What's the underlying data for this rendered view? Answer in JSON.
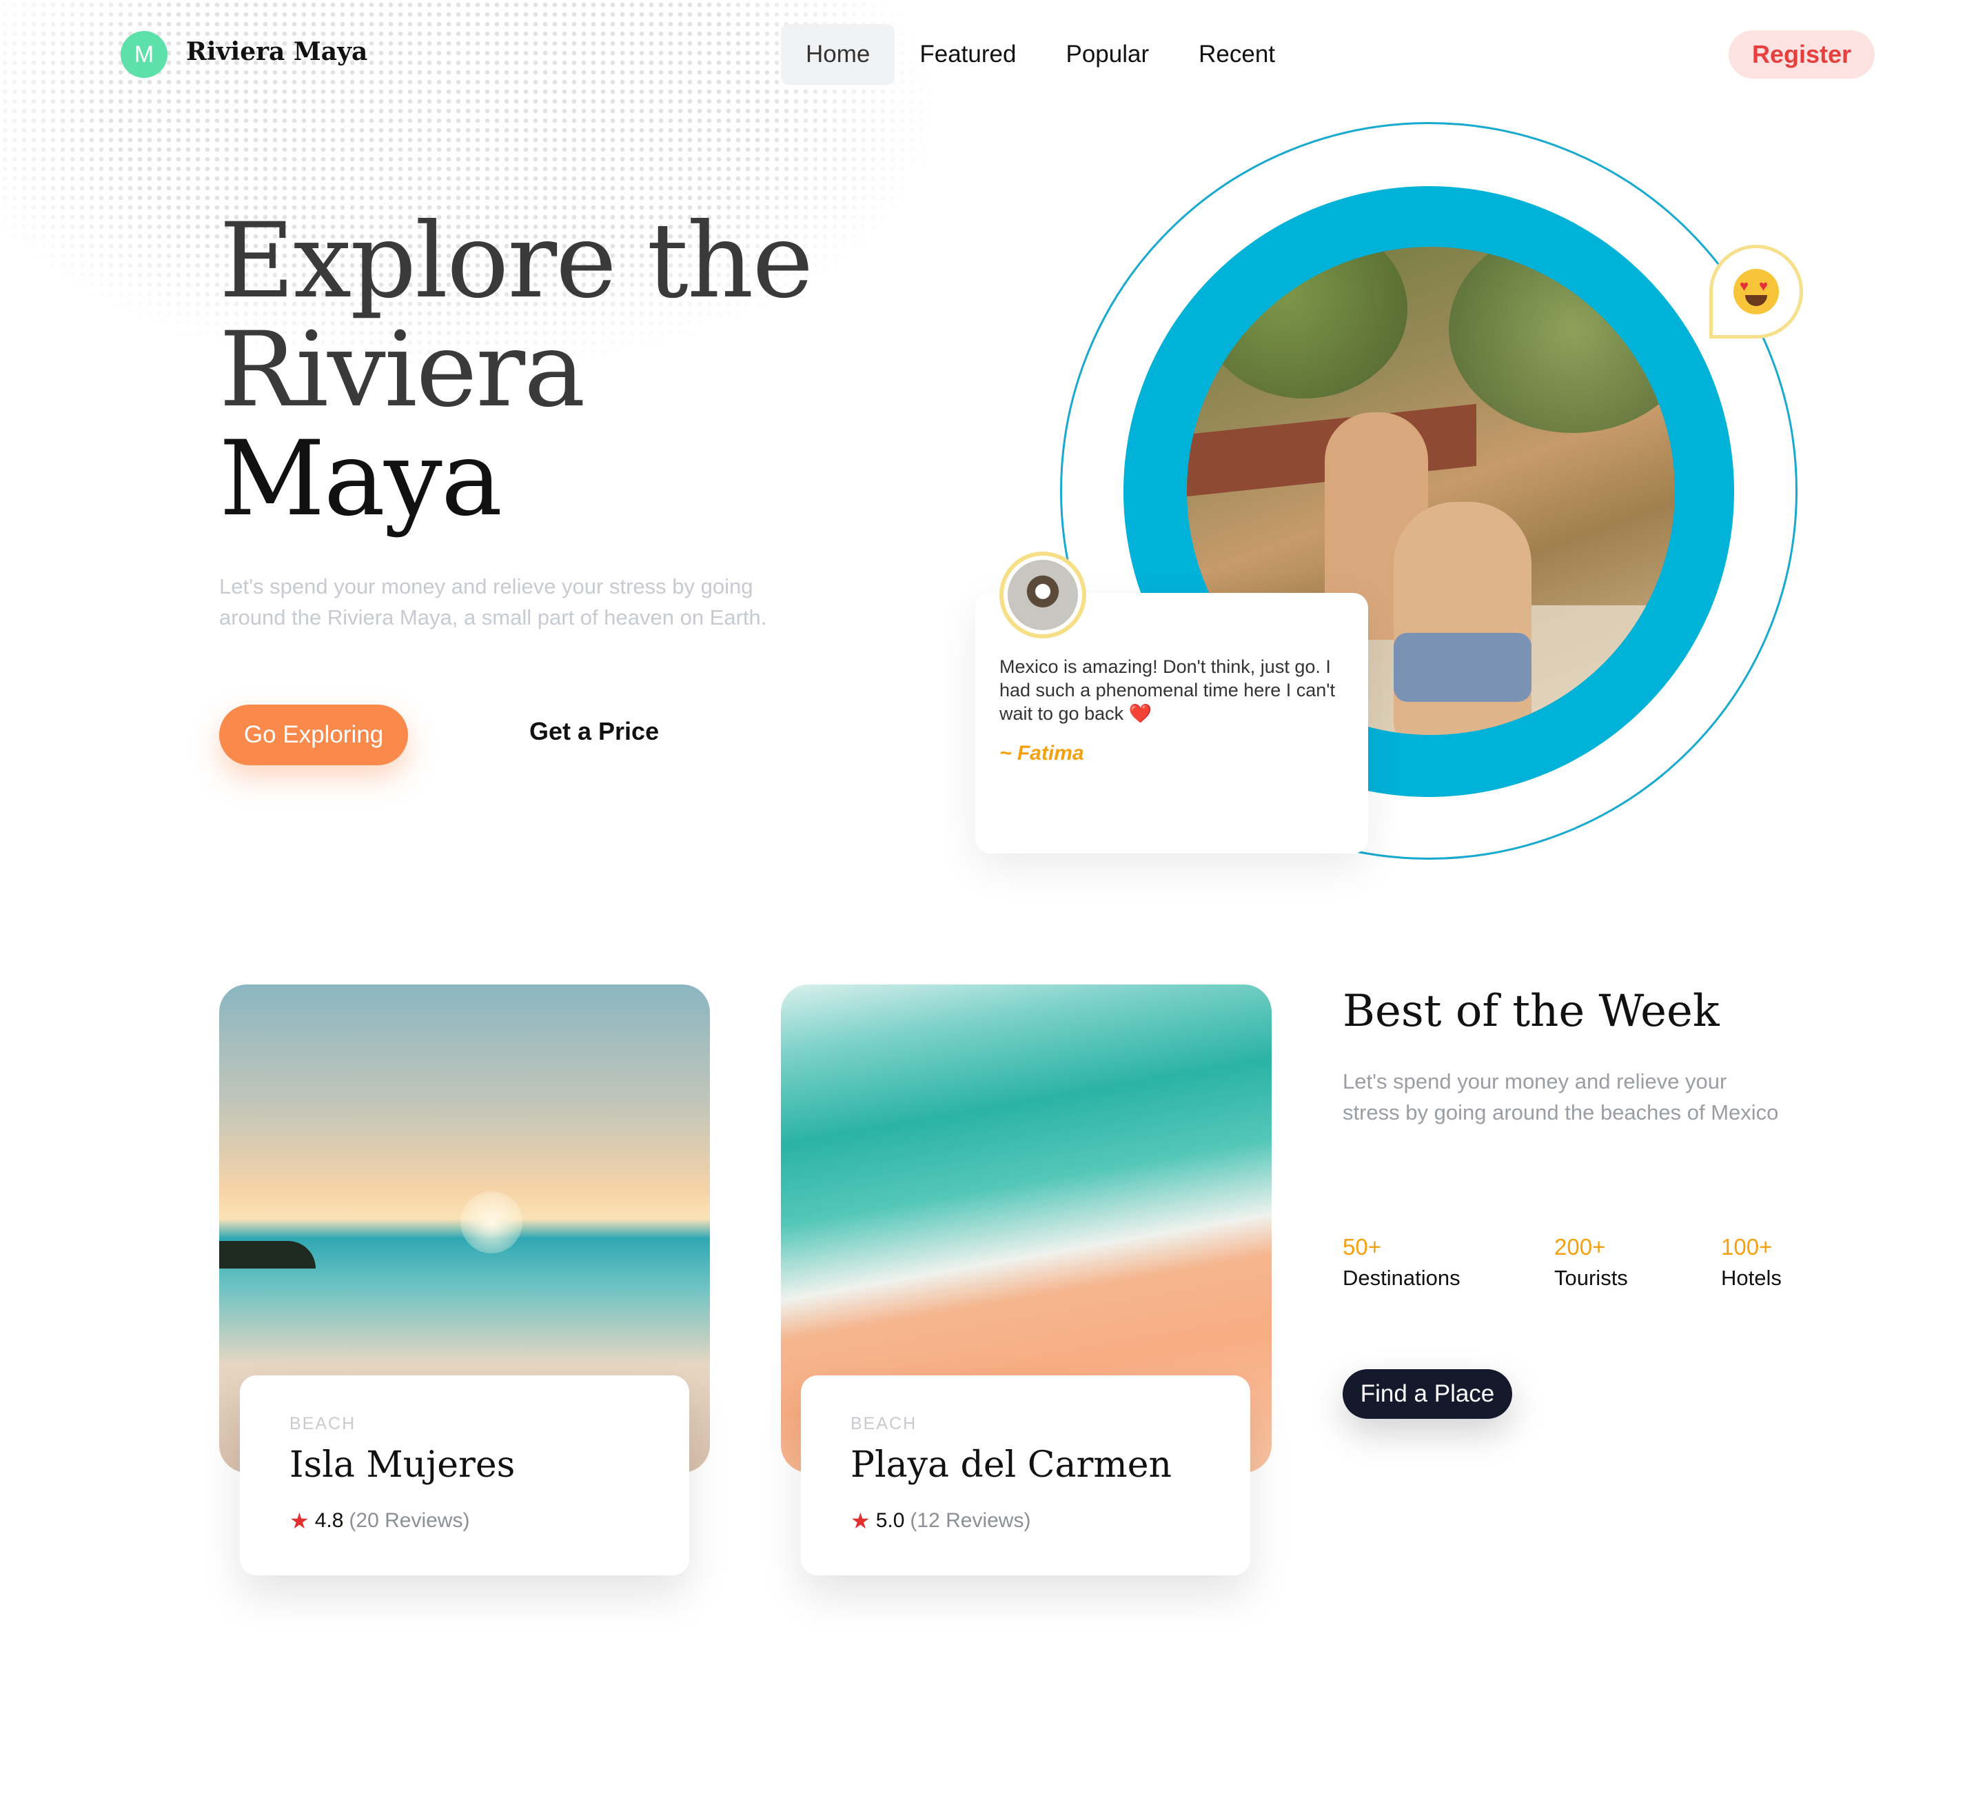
{
  "header": {
    "logo_letter": "M",
    "brand": "Riviera Maya",
    "nav": [
      "Home",
      "Featured",
      "Popular",
      "Recent"
    ],
    "active_nav": "Home",
    "register_label": "Register"
  },
  "hero": {
    "title_line1": "Explore the",
    "title_line2": "Riviera",
    "title_line3": "Maya",
    "subtitle": "Let's spend your money and relieve your stress by going around the Riviera Maya, a small part of heaven on Earth.",
    "primary_cta": "Go Exploring",
    "secondary_cta": "Get a Price"
  },
  "testimonial": {
    "text": "Mexico is amazing! Don't think, just go. I had such a phenomenal time here I can't wait to go back ❤️",
    "author": "~ Fatima"
  },
  "cards": [
    {
      "category": "BEACH",
      "title": "Isla Mujeres",
      "rating": "4.8",
      "reviews": "(20 Reviews)"
    },
    {
      "category": "BEACH",
      "title": "Playa del Carmen",
      "rating": "5.0",
      "reviews": "(12 Reviews)"
    }
  ],
  "best": {
    "title": "Best of the Week",
    "subtitle": "Let's spend your money and relieve your stress by going around the beaches of Mexico",
    "stats": [
      {
        "value": "50+",
        "label": "Destinations"
      },
      {
        "value": "200+",
        "label": "Tourists"
      },
      {
        "value": "100+",
        "label": "Hotels"
      }
    ],
    "cta": "Find a Place"
  },
  "colors": {
    "accent_orange": "#f98a4c",
    "ring_blue": "#00b1d8",
    "register_red": "#e73e3e",
    "stat_amber": "#f5a00f",
    "dark_button": "#141a2b"
  },
  "icons": [
    "star-icon",
    "heart-eyes-emoji-icon"
  ]
}
